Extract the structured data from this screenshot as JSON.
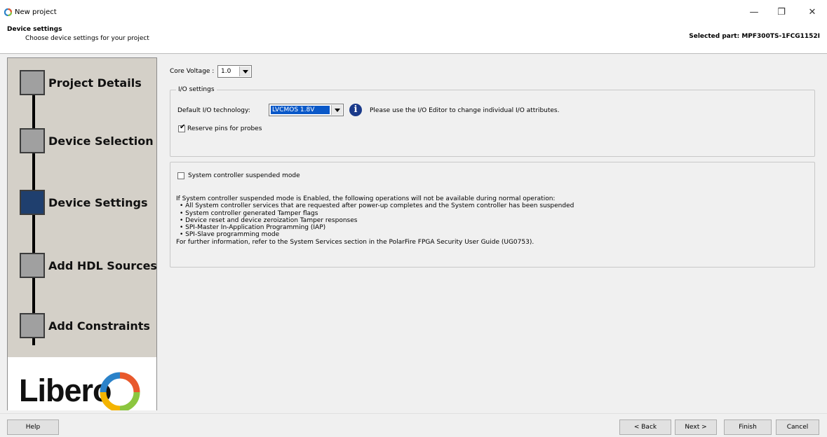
{
  "window": {
    "title": "New project",
    "minimize_glyph": "—",
    "restore_glyph": "❐",
    "close_glyph": "✕"
  },
  "header": {
    "title": "Device settings",
    "subtitle": "Choose device settings for your project",
    "selected_part": "Selected part: MPF300TS-1FCG1152I"
  },
  "wizard": {
    "steps": [
      {
        "label": "Project Details",
        "active": false
      },
      {
        "label": "Device Selection",
        "active": false
      },
      {
        "label": "Device Settings",
        "active": true
      },
      {
        "label": "Add HDL Sources",
        "active": false
      },
      {
        "label": "Add Constraints",
        "active": false
      }
    ],
    "logo_text": "Libero"
  },
  "core_voltage": {
    "label": "Core Voltage :",
    "value": "1.0"
  },
  "io_settings": {
    "legend": "I/O settings",
    "default_io_label": "Default I/O technology:",
    "default_io_value": "LVCMOS 1.8V",
    "info_glyph": "i",
    "info_text": "Please use the I/O Editor to change individual I/O attributes.",
    "reserve_pins_label": "Reserve pins for probes",
    "reserve_pins_checked": true
  },
  "system_controller": {
    "checkbox_label": "System controller suspended mode",
    "checked": false,
    "intro": "If System controller suspended mode is Enabled, the following operations will not be available during normal operation:",
    "bullets": [
      "All System controller services that are requested after power-up completes and the System controller has been suspended",
      "System controller generated Tamper flags",
      "Device reset and device zeroization Tamper responses",
      "SPI-Master In-Application Programming (IAP)",
      "SPI-Slave programming mode"
    ],
    "footer": "For further information, refer to the System Services section in the PolarFire FPGA Security User Guide (UG0753)."
  },
  "buttons": {
    "help": "Help",
    "back": "< Back",
    "next": "Next >",
    "finish": "Finish",
    "cancel": "Cancel"
  },
  "colors": {
    "active_step": "#1f3f6e",
    "inactive_step": "#a0a0a0",
    "selection_highlight": "#0a58c8",
    "info_icon": "#1a3a8a"
  }
}
